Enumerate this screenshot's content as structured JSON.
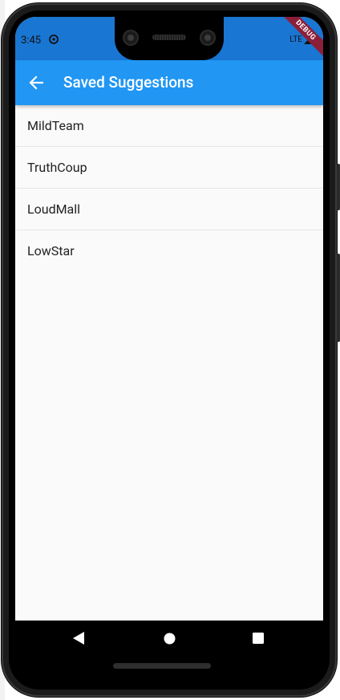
{
  "status_bar": {
    "time": "3:45",
    "network": "LTE",
    "sync_icon": "sync-icon",
    "signal_icon": "signal-icon"
  },
  "debug_banner": "DEBUG",
  "app_bar": {
    "title": "Saved Suggestions",
    "back_icon": "arrow-back-icon"
  },
  "saved_list": {
    "items": [
      "MildTeam",
      "TruthCoup",
      "LoudMall",
      "LowStar"
    ]
  },
  "nav_bar": {
    "back_icon": "triangle-back-icon",
    "home_icon": "circle-home-icon",
    "recents_icon": "square-recents-icon"
  },
  "colors": {
    "app_bar": "#2196f3",
    "status_bar": "#1976d2",
    "background": "#fafafa",
    "divider": "#e6e6e6",
    "debug_ribbon": "#8b1f3a"
  }
}
